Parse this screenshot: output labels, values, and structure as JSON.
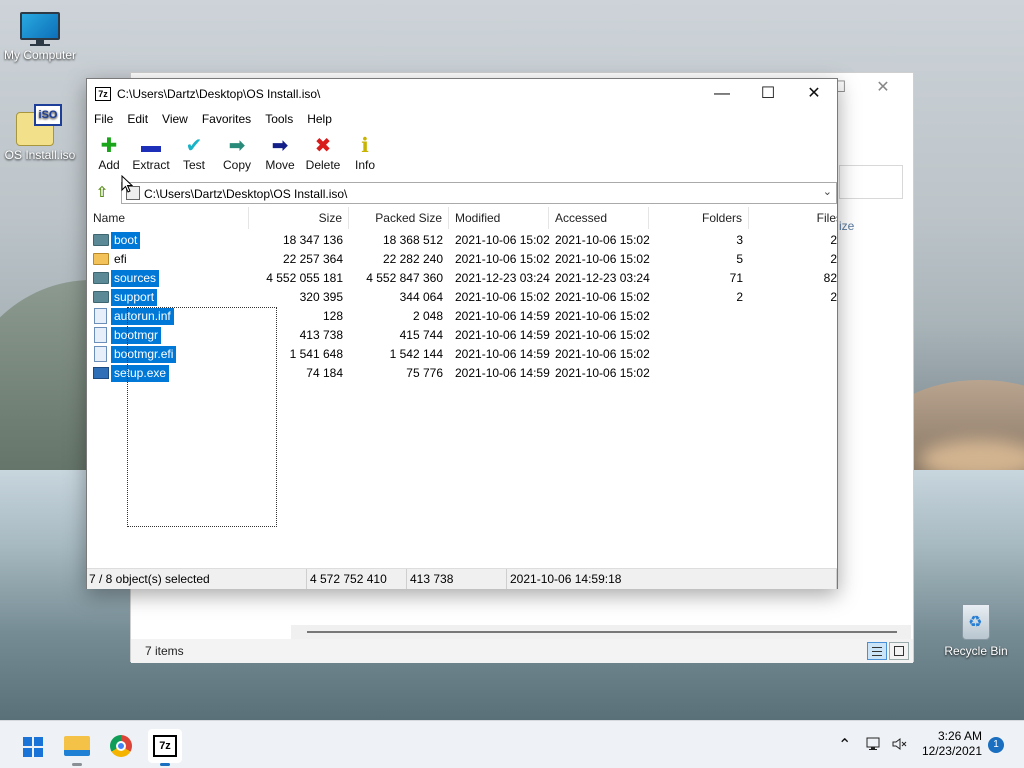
{
  "desktop": {
    "icons": [
      {
        "label": "My Computer",
        "icon": "monitor-icon"
      },
      {
        "label": "OS Install.iso",
        "icon": "iso-file-icon",
        "badge": "iSO"
      },
      {
        "label": "Recycle Bin",
        "icon": "recycle-bin-icon"
      }
    ]
  },
  "explorer": {
    "status_items": "7 items"
  },
  "zip": {
    "app_icon_text": "7z",
    "title": "C:\\Users\\Dartz\\Desktop\\OS Install.iso\\",
    "window_buttons": {
      "minimize": "—",
      "maximize": "☐",
      "close": "✕"
    },
    "menu": [
      "File",
      "Edit",
      "View",
      "Favorites",
      "Tools",
      "Help"
    ],
    "toolbar": [
      {
        "label": "Add",
        "glyph": "✚",
        "color": "#1aa51a"
      },
      {
        "label": "Extract",
        "glyph": "▬",
        "color": "#1d2fb8"
      },
      {
        "label": "Test",
        "glyph": "✔",
        "color": "#19b3c8"
      },
      {
        "label": "Copy",
        "glyph": "➡",
        "color": "#2a8a7a"
      },
      {
        "label": "Move",
        "glyph": "➡",
        "color": "#14208a"
      },
      {
        "label": "Delete",
        "glyph": "✖",
        "color": "#d81c1c"
      },
      {
        "label": "Info",
        "glyph": "ℹ",
        "color": "#c7b300"
      }
    ],
    "address": "C:\\Users\\Dartz\\Desktop\\OS Install.iso\\",
    "columns": [
      "Name",
      "Size",
      "Packed Size",
      "Modified",
      "Accessed",
      "Folders",
      "Files"
    ],
    "rows": [
      {
        "name": "boot",
        "type": "folder",
        "selected": true,
        "size": "18 347 136",
        "packed": "18 368 512",
        "modified": "2021-10-06 15:02",
        "accessed": "2021-10-06 15:02",
        "folders": "3",
        "files": "2"
      },
      {
        "name": "efi",
        "type": "folder-open",
        "selected": false,
        "size": "22 257 364",
        "packed": "22 282 240",
        "modified": "2021-10-06 15:02",
        "accessed": "2021-10-06 15:02",
        "folders": "5",
        "files": "2"
      },
      {
        "name": "sources",
        "type": "folder",
        "selected": true,
        "size": "4 552 055 181",
        "packed": "4 552 847 360",
        "modified": "2021-12-23 03:24",
        "accessed": "2021-12-23 03:24",
        "folders": "71",
        "files": "82"
      },
      {
        "name": "support",
        "type": "folder",
        "selected": true,
        "size": "320 395",
        "packed": "344 064",
        "modified": "2021-10-06 15:02",
        "accessed": "2021-10-06 15:02",
        "folders": "2",
        "files": "2"
      },
      {
        "name": "autorun.inf",
        "type": "file",
        "selected": true,
        "size": "128",
        "packed": "2 048",
        "modified": "2021-10-06 14:59",
        "accessed": "2021-10-06 15:02",
        "folders": "",
        "files": ""
      },
      {
        "name": "bootmgr",
        "type": "file",
        "selected": true,
        "size": "413 738",
        "packed": "415 744",
        "modified": "2021-10-06 14:59",
        "accessed": "2021-10-06 15:02",
        "folders": "",
        "files": ""
      },
      {
        "name": "bootmgr.efi",
        "type": "file",
        "selected": true,
        "size": "1 541 648",
        "packed": "1 542 144",
        "modified": "2021-10-06 14:59",
        "accessed": "2021-10-06 15:02",
        "folders": "",
        "files": ""
      },
      {
        "name": "setup.exe",
        "type": "exe",
        "selected": true,
        "size": "74 184",
        "packed": "75 776",
        "modified": "2021-10-06 14:59",
        "accessed": "2021-10-06 15:02",
        "folders": "",
        "files": ""
      }
    ],
    "status": {
      "selection": "7 / 8 object(s) selected",
      "total_size": "4 572 752 410",
      "item_size": "413 738",
      "item_date": "2021-10-06 14:59:18"
    }
  },
  "taskbar": {
    "apps": [
      "start-icon",
      "file-explorer-icon",
      "chrome-icon",
      "7zip-icon"
    ],
    "time": "3:26 AM",
    "date": "12/23/2021",
    "notification_count": "1"
  },
  "colors": {
    "selection": "#0078d7",
    "taskbar": "#eef1f5"
  }
}
